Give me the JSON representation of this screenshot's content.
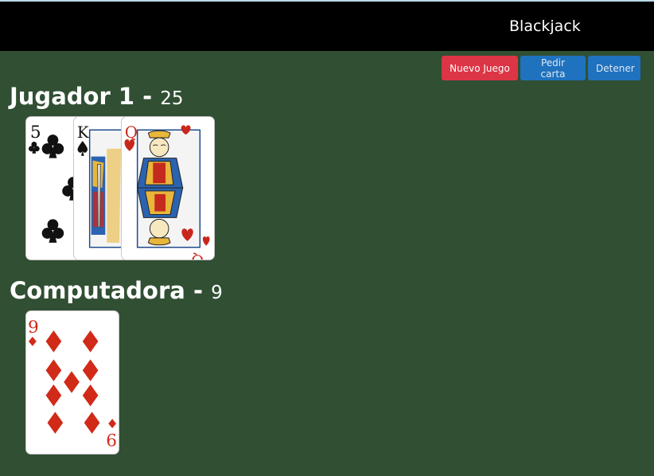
{
  "header": {
    "title": "Blackjack"
  },
  "toolbar": {
    "new_game": "Nuevo Juego",
    "hit": "Pedir carta",
    "stop": "Detener"
  },
  "players": [
    {
      "name": "Jugador 1",
      "separator": "-",
      "score": "25",
      "cards": [
        {
          "rank": "5",
          "suit": "clubs"
        },
        {
          "rank": "K",
          "suit": "spades"
        },
        {
          "rank": "Q",
          "suit": "hearts"
        }
      ]
    },
    {
      "name": "Computadora",
      "separator": "-",
      "score": "9",
      "cards": [
        {
          "rank": "9",
          "suit": "diamonds"
        }
      ]
    }
  ],
  "colors": {
    "table": "#314f33",
    "header": "#000000",
    "danger": "#dc3545",
    "primary": "#1f72be",
    "red_suit": "#d12a19"
  }
}
